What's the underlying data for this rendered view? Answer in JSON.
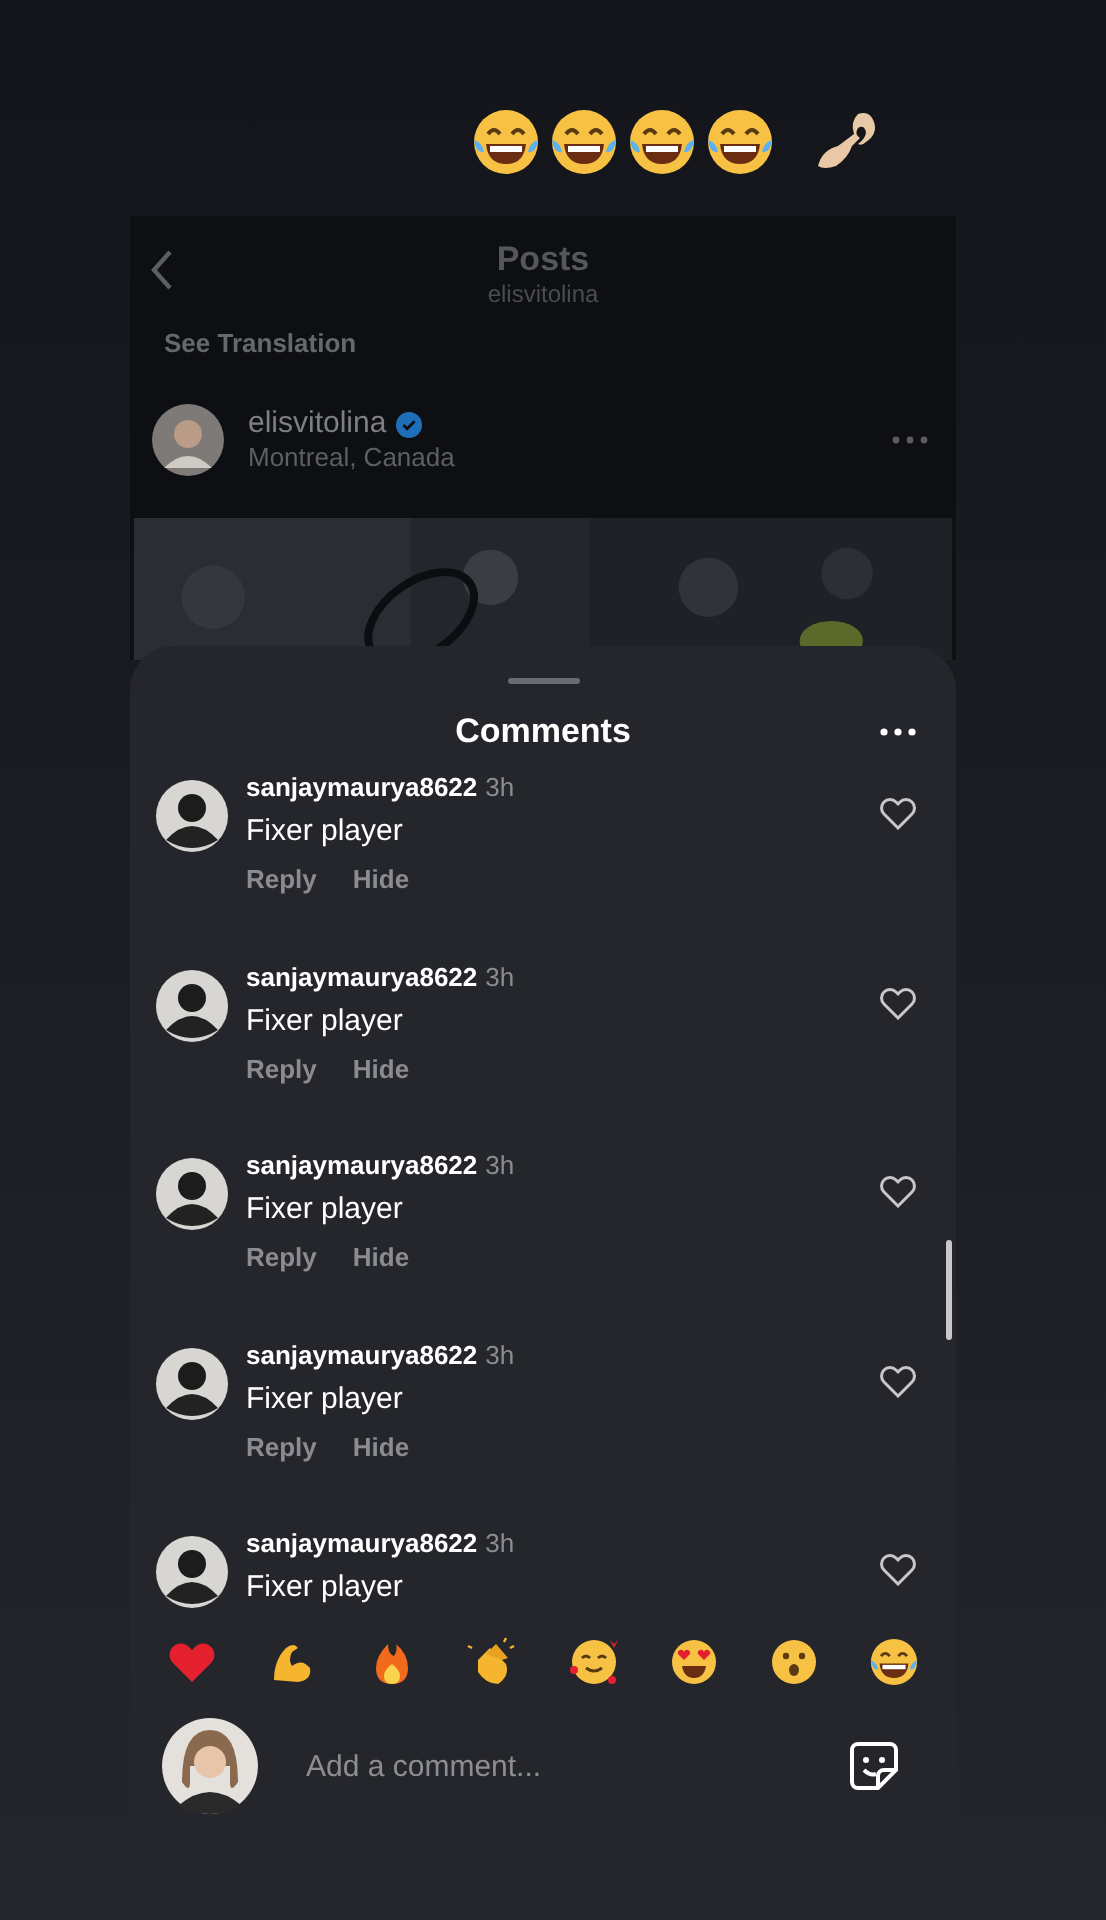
{
  "background_post": {
    "title": "Posts",
    "subtitle": "elisvitolina",
    "see_translation": "See Translation",
    "author": {
      "username": "elisvitolina",
      "verified": true,
      "location": "Montreal, Canada"
    }
  },
  "comments_sheet": {
    "title": "Comments",
    "comments": [
      {
        "username": "sanjaymaurya8622",
        "time": "3h",
        "text": "Fixer player",
        "liked": false,
        "actions": [
          "Reply",
          "Hide"
        ]
      },
      {
        "username": "sanjaymaurya8622",
        "time": "3h",
        "text": "Fixer player",
        "liked": false,
        "actions": [
          "Reply",
          "Hide"
        ]
      },
      {
        "username": "sanjaymaurya8622",
        "time": "3h",
        "text": "Fixer player",
        "liked": false,
        "actions": [
          "Reply",
          "Hide"
        ]
      },
      {
        "username": "sanjaymaurya8622",
        "time": "3h",
        "text": "Fixer player",
        "liked": false,
        "actions": [
          "Reply",
          "Hide"
        ]
      },
      {
        "username": "sanjaymaurya8622",
        "time": "3h",
        "text": "Fixer player",
        "liked": false
      }
    ],
    "composer": {
      "placeholder": "Add a comment..."
    }
  }
}
